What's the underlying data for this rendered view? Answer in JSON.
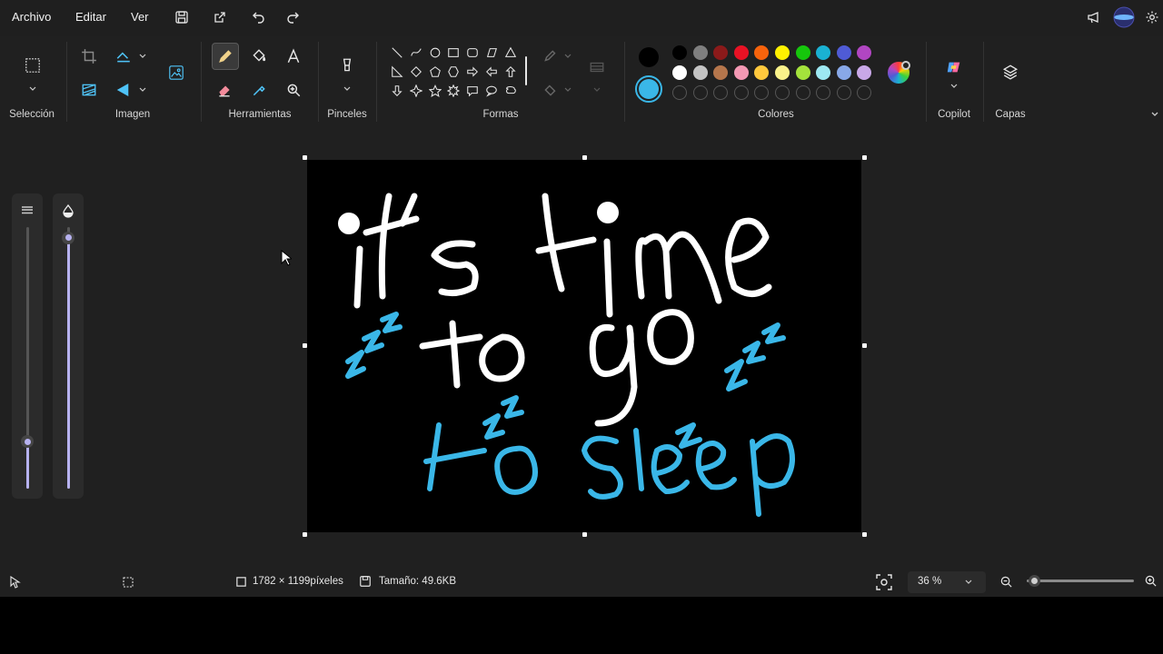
{
  "menu": {
    "file": "Archivo",
    "edit": "Editar",
    "view": "Ver"
  },
  "quick_access_icons": [
    "save-icon",
    "share-icon",
    "undo-icon",
    "redo-icon"
  ],
  "top_right_icons": [
    "megaphone-icon",
    "account-avatar",
    "settings-icon"
  ],
  "ribbon": {
    "groups": {
      "selection": "Selección",
      "image": "Imagen",
      "tools": "Herramientas",
      "brushes": "Pinceles",
      "shapes": "Formas",
      "colors": "Colores",
      "copilot": "Copilot",
      "layers": "Capas"
    },
    "active_tool": "pencil"
  },
  "colors": {
    "primary": "#000000",
    "secondary": "#3ab7e8",
    "palette_row1": [
      "#000000",
      "#7f7f7f",
      "#8b1a1a",
      "#e81224",
      "#f7630c",
      "#fff100",
      "#16c60c",
      "#1ab1d2",
      "#4f5bd5",
      "#b146c2"
    ],
    "palette_row2": [
      "#ffffff",
      "#c3c3c3",
      "#b5764c",
      "#f398b3",
      "#ffc83d",
      "#f9f28a",
      "#a4e33c",
      "#9de8f2",
      "#88a8e8",
      "#c9a8e8"
    ]
  },
  "canvas": {
    "background": "#000000",
    "white_text": [
      "it's time",
      "to go"
    ],
    "blue_text": "to sleep",
    "stroke_white": "#ffffff",
    "stroke_blue": "#3ab7e8"
  },
  "sliders": {
    "size_level": 0.18,
    "opacity_level": 0.96,
    "accent": "#b7b2f0"
  },
  "status": {
    "dimensions": "1782 × 1199píxeles",
    "size": "Tamaño: 49.6KB",
    "zoom": "36 %",
    "zoom_level": 0.07
  }
}
